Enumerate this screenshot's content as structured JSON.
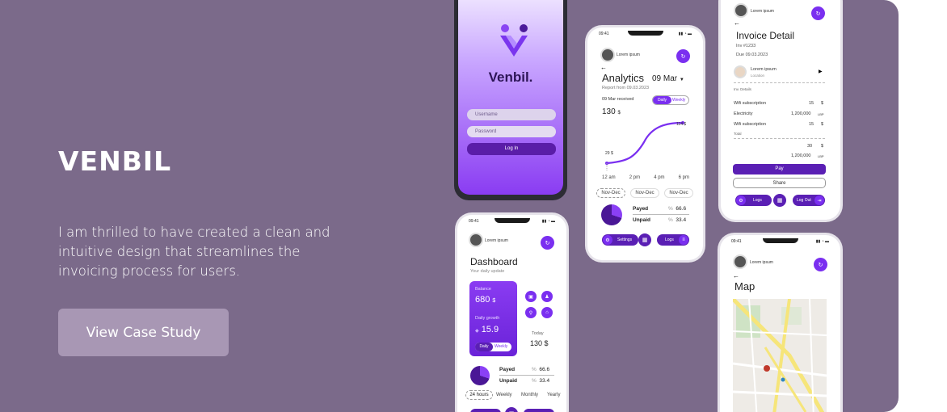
{
  "hero": {
    "title": "VENBIL",
    "description": "I am thrilled to have created a clean and intuitive design that streamlines the invoicing process for users.",
    "cta_label": "View Case Study"
  },
  "login_screen": {
    "brand": "Venbil.",
    "username_placeholder": "Username",
    "password_placeholder": "Password",
    "login_label": "Log In"
  },
  "analytics_screen": {
    "time": "09:41",
    "user": "Lorem ipsum",
    "title": "Analytics",
    "date": "09 Mar",
    "report": "Report from 09.03.2023",
    "received": "09 Mar received",
    "toggle_daily": "Daily",
    "toggle_weekly": "Weekly",
    "amount": "130",
    "currency": "$",
    "point_low": "29 $",
    "point_high": "114 $",
    "hours": [
      "12 am",
      "2 pm",
      "4 pm",
      "6 pm"
    ],
    "ranges": [
      "Nov-Dec",
      "Nov-Dec",
      "Nov-Dec"
    ],
    "payed_label": "Payed",
    "payed_value": "66.6",
    "unpaid_label": "Unpaid",
    "unpaid_value": "33.4",
    "pct": "%",
    "nav_settings": "Settings",
    "nav_logs": "Logs"
  },
  "invoice_screen": {
    "user": "Lorem ipsum",
    "title": "Invoice Detail",
    "inv": "Inv  #1233",
    "due": "Due 09.03.2023",
    "client_name": "Lorem ipsum",
    "client_loc": "Location",
    "section": "Inv. Details",
    "rows": [
      {
        "name": "Wifi subscription",
        "value": "15",
        "cur": "$"
      },
      {
        "name": "Electricity",
        "value": "1,200,000",
        "cur": "LBP"
      },
      {
        "name": "Wifi subscription",
        "value": "15",
        "cur": "$"
      }
    ],
    "total_label": "Total",
    "total_usd": "30",
    "total_usd_cur": "$",
    "total_lbp": "1,200,000",
    "total_lbp_cur": "LBP",
    "pay_label": "Pay",
    "share_label": "Share",
    "nav_logs": "Logs",
    "nav_logout": "Log Out"
  },
  "dashboard_screen": {
    "time": "09:41",
    "user": "Lorem ipsum",
    "title": "Dashboard",
    "subtitle": "Your daily update",
    "balance_label": "Balance",
    "balance_value": "680",
    "currency": "$",
    "growth_label": "Daily growth",
    "growth_value": "15.9",
    "toggle_daily": "Daily",
    "toggle_weekly": "Weekly",
    "today_label": "Today",
    "today_value": "130 $",
    "payed_label": "Payed",
    "payed_value": "66.6",
    "unpaid_label": "Unpaid",
    "unpaid_value": "33.4",
    "pct": "%",
    "periods": [
      "24 hours",
      "Weekly",
      "Monthly",
      "Yearly"
    ]
  },
  "map_screen": {
    "time": "09:41",
    "user": "Lorem ipsum",
    "title": "Map"
  },
  "colors": {
    "card_bg": "#7b6a8a",
    "accent": "#7a2ff0",
    "button_bg": "#a897b4"
  }
}
